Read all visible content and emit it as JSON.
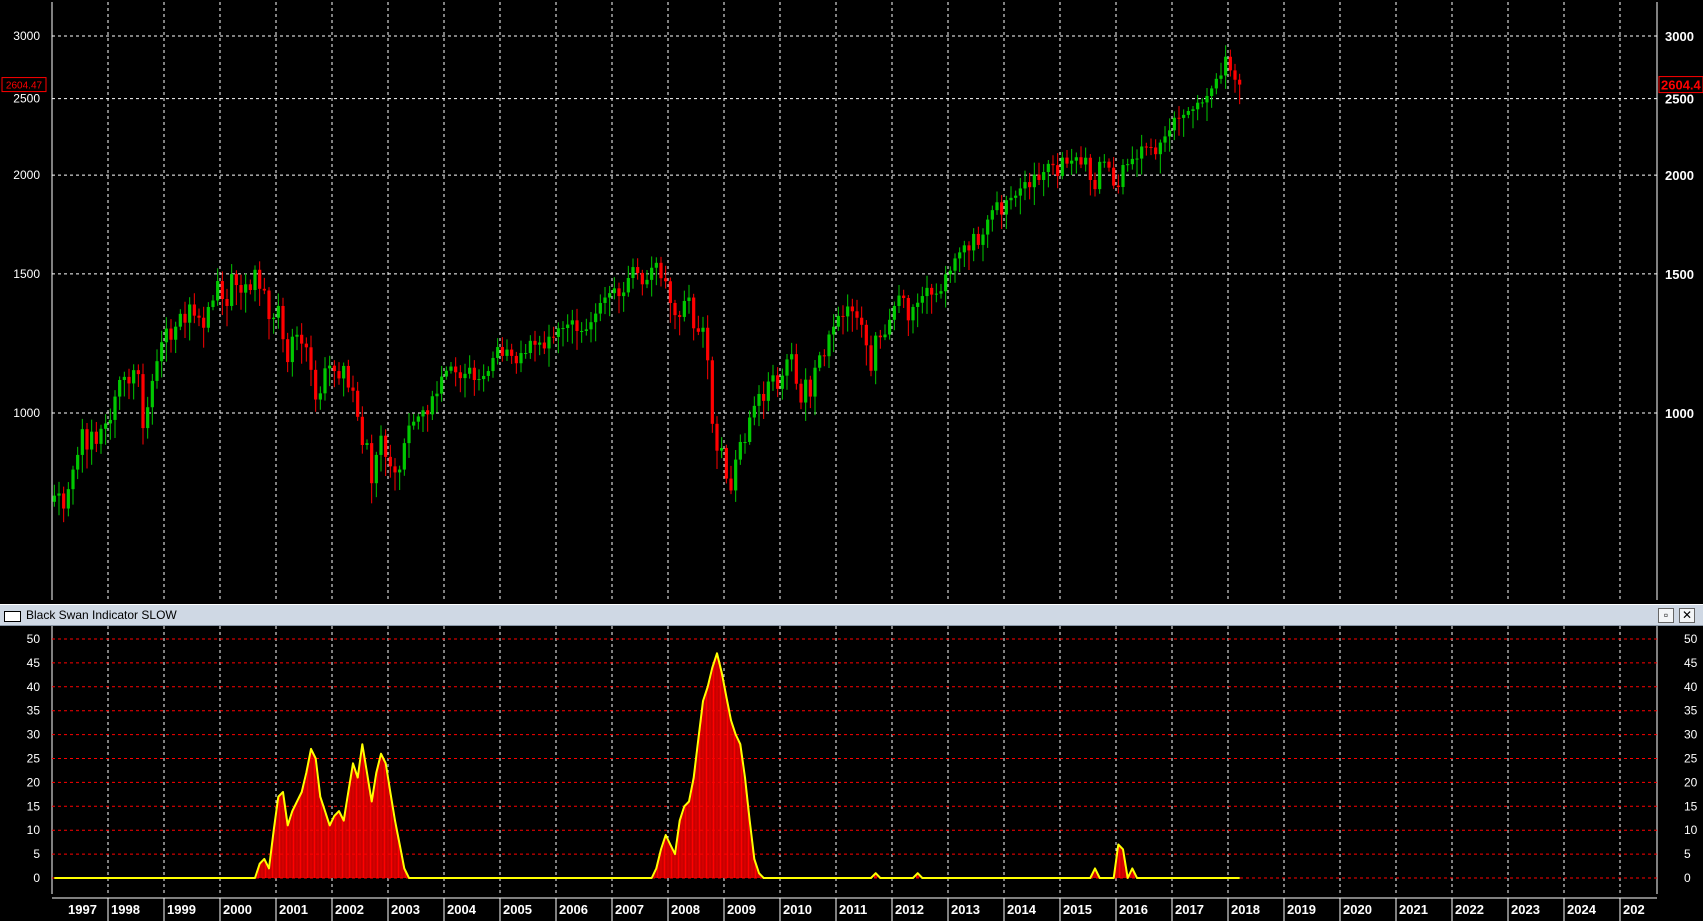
{
  "indicator_panel": {
    "title": "Black Swan Indicator SLOW",
    "maximize_icon": "maximize-icon",
    "close_icon": "close-icon"
  },
  "colors": {
    "background": "#000000",
    "grid": "#ffffff",
    "up_candle": "#00c800",
    "down_candle": "#ff0000",
    "indicator_line": "#ffff00",
    "indicator_bars": "#ff0000",
    "indicator_grid": "#ff0000",
    "price_label": "#ff0000"
  },
  "chart_data": [
    {
      "type": "candlestick",
      "scale": "log",
      "y_ticks": [
        "1000",
        "1500",
        "2000",
        "2500",
        "3000"
      ],
      "last_price_label_left": "2604.47",
      "last_price_label_right": "2604.4",
      "x_labels": [
        "1997",
        "1998",
        "1999",
        "2000",
        "2001",
        "2002",
        "2003",
        "2004",
        "2005",
        "2006",
        "2007",
        "2008",
        "2009",
        "2010",
        "2011",
        "2012",
        "2013",
        "2014",
        "2015",
        "2016",
        "2017",
        "2018",
        "2019",
        "2020",
        "2021",
        "2022",
        "2023",
        "2024",
        "202"
      ],
      "ylim": [
        650,
        3200
      ],
      "monthly_close": {
        "start": "1997-01",
        "values": [
          786,
          791,
          757,
          801,
          848,
          885,
          954,
          899,
          947,
          914,
          955,
          970,
          980,
          1049,
          1101,
          1111,
          1090,
          1133,
          1120,
          957,
          1017,
          1098,
          1163,
          1229,
          1279,
          1238,
          1286,
          1335,
          1301,
          1372,
          1328,
          1320,
          1282,
          1362,
          1388,
          1469,
          1394,
          1366,
          1499,
          1452,
          1420,
          1455,
          1431,
          1518,
          1436,
          1429,
          1315,
          1320,
          1366,
          1240,
          1160,
          1249,
          1256,
          1224,
          1211,
          1134,
          1040,
          1059,
          1139,
          1148,
          1130,
          1106,
          1147,
          1077,
          1067,
          989,
          911,
          916,
          815,
          885,
          936,
          880,
          856,
          841,
          848,
          916,
          964,
          975,
          990,
          1008,
          996,
          1050,
          1058,
          1112,
          1131,
          1145,
          1126,
          1107,
          1121,
          1141,
          1101,
          1104,
          1114,
          1130,
          1174,
          1212,
          1181,
          1203,
          1181,
          1156,
          1191,
          1191,
          1234,
          1220,
          1228,
          1207,
          1249,
          1248,
          1280,
          1281,
          1294,
          1310,
          1270,
          1270,
          1276,
          1303,
          1336,
          1378,
          1400,
          1418,
          1438,
          1406,
          1421,
          1482,
          1530,
          1504,
          1455,
          1474,
          1527,
          1549,
          1481,
          1468,
          1378,
          1330,
          1323,
          1386,
          1400,
          1280,
          1267,
          1282,
          1166,
          969,
          896,
          903,
          826,
          798,
          873,
          919,
          919,
          987,
          1021,
          1057,
          1036,
          1096,
          1116,
          1073,
          1115,
          1169,
          1187,
          1089,
          1031,
          1102,
          1049,
          1141,
          1183,
          1180,
          1257,
          1286,
          1327,
          1325,
          1364,
          1345,
          1320,
          1293,
          1218,
          1131,
          1253,
          1247,
          1257,
          1312,
          1366,
          1408,
          1398,
          1310,
          1362,
          1379,
          1406,
          1440,
          1412,
          1416,
          1426,
          1498,
          1514,
          1569,
          1597,
          1630,
          1606,
          1685,
          1632,
          1682,
          1757,
          1806,
          1848,
          1783,
          1859,
          1872,
          1884,
          1924,
          1960,
          1931,
          2003,
          1972,
          2018,
          2067,
          2059,
          1995,
          2105,
          2068,
          2086,
          2107,
          2063,
          2104,
          1972,
          1920,
          2079,
          2080,
          2044,
          1940,
          1932,
          2060,
          2065,
          2097,
          2099,
          2174,
          2171,
          2168,
          2126,
          2199,
          2239,
          2279,
          2364,
          2363,
          2384,
          2411,
          2423,
          2470,
          2472,
          2519,
          2575,
          2648,
          2674,
          2824,
          2714,
          2641,
          2604
        ]
      }
    },
    {
      "type": "area",
      "title": "Black Swan Indicator SLOW",
      "ylim": [
        0,
        50
      ],
      "y_ticks": [
        "0",
        "5",
        "10",
        "15",
        "20",
        "25",
        "30",
        "35",
        "40",
        "45",
        "50"
      ],
      "x_labels": [
        "1997",
        "1998",
        "1999",
        "2000",
        "2001",
        "2002",
        "2003",
        "2004",
        "2005",
        "2006",
        "2007",
        "2008",
        "2009",
        "2010",
        "2011",
        "2012",
        "2013",
        "2014",
        "2015",
        "2016",
        "2017",
        "2018",
        "2019",
        "2020",
        "2021",
        "2022",
        "2023",
        "2024",
        "202"
      ],
      "points": [
        [
          "1997-01",
          0
        ],
        [
          "2000-08",
          0
        ],
        [
          "2000-09",
          3
        ],
        [
          "2000-10",
          4
        ],
        [
          "2000-11",
          2
        ],
        [
          "2000-12",
          10
        ],
        [
          "2001-01",
          17
        ],
        [
          "2001-02",
          18
        ],
        [
          "2001-03",
          11
        ],
        [
          "2001-04",
          14
        ],
        [
          "2001-05",
          16
        ],
        [
          "2001-06",
          18
        ],
        [
          "2001-07",
          22
        ],
        [
          "2001-08",
          27
        ],
        [
          "2001-09",
          25
        ],
        [
          "2001-10",
          17
        ],
        [
          "2001-11",
          14
        ],
        [
          "2001-12",
          11
        ],
        [
          "2002-01",
          13
        ],
        [
          "2002-02",
          14
        ],
        [
          "2002-03",
          12
        ],
        [
          "2002-04",
          18
        ],
        [
          "2002-05",
          24
        ],
        [
          "2002-06",
          21
        ],
        [
          "2002-07",
          28
        ],
        [
          "2002-08",
          22
        ],
        [
          "2002-09",
          16
        ],
        [
          "2002-10",
          22
        ],
        [
          "2002-11",
          26
        ],
        [
          "2002-12",
          24
        ],
        [
          "2003-01",
          18
        ],
        [
          "2003-02",
          12
        ],
        [
          "2003-03",
          7
        ],
        [
          "2003-04",
          2
        ],
        [
          "2003-05",
          0
        ],
        [
          "2007-09",
          0
        ],
        [
          "2007-10",
          2
        ],
        [
          "2007-11",
          6
        ],
        [
          "2007-12",
          9
        ],
        [
          "2008-01",
          7
        ],
        [
          "2008-02",
          5
        ],
        [
          "2008-03",
          12
        ],
        [
          "2008-04",
          15
        ],
        [
          "2008-05",
          16
        ],
        [
          "2008-06",
          21
        ],
        [
          "2008-07",
          29
        ],
        [
          "2008-08",
          37
        ],
        [
          "2008-09",
          40
        ],
        [
          "2008-10",
          44
        ],
        [
          "2008-11",
          47
        ],
        [
          "2008-12",
          43
        ],
        [
          "2009-01",
          38
        ],
        [
          "2009-02",
          33
        ],
        [
          "2009-03",
          30
        ],
        [
          "2009-04",
          28
        ],
        [
          "2009-05",
          21
        ],
        [
          "2009-06",
          12
        ],
        [
          "2009-07",
          4
        ],
        [
          "2009-08",
          1
        ],
        [
          "2009-09",
          0
        ],
        [
          "2011-08",
          0
        ],
        [
          "2011-09",
          1
        ],
        [
          "2011-10",
          0
        ],
        [
          "2012-05",
          0
        ],
        [
          "2012-06",
          1
        ],
        [
          "2012-07",
          0
        ],
        [
          "2015-07",
          0
        ],
        [
          "2015-08",
          2
        ],
        [
          "2015-09",
          0
        ],
        [
          "2015-12",
          0
        ],
        [
          "2016-01",
          7
        ],
        [
          "2016-02",
          6
        ],
        [
          "2016-03",
          0
        ],
        [
          "2016-04",
          2
        ],
        [
          "2016-05",
          0
        ],
        [
          "2018-03",
          0
        ]
      ]
    }
  ]
}
